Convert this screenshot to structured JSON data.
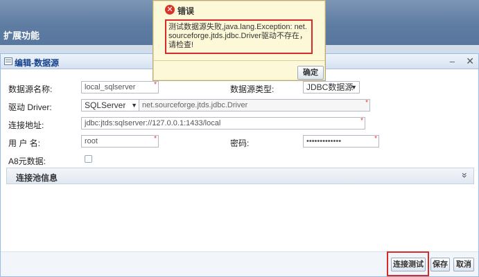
{
  "header": {
    "title": "扩展功能"
  },
  "window": {
    "title": "编辑-数据源",
    "minimize_glyph": "–",
    "close_glyph": "✕"
  },
  "form": {
    "ds_name_label": "数据源名称:",
    "ds_name_value": "local_sqlserver",
    "ds_type_label": "数据源类型:",
    "ds_type_value": "JDBC数据源",
    "driver_label": "驱动 Driver:",
    "driver_type_value": "SQLServer",
    "driver_class_value": "net.sourceforge.jtds.jdbc.Driver",
    "url_label": "连接地址:",
    "url_value": "jdbc:jtds:sqlserver://127.0.0.1:1433/local",
    "user_label": "用 户 名:",
    "user_value": "root",
    "password_label": "密码:",
    "password_value": "•••••••••••••",
    "a8_label": "A8元数据:",
    "required_mark": "*"
  },
  "pool_panel": {
    "title": "连接池信息",
    "expand_glyph": "»"
  },
  "footer": {
    "test_label": "连接测试",
    "save_label": "保存",
    "cancel_label": "取消"
  },
  "dialog": {
    "title": "错误",
    "icon_glyph": "✕",
    "message": "测试数据源失败,java.lang.Exception: net.sourceforge.jtds.jdbc.Driver驱动不存在，请检查!",
    "ok_label": "确定"
  },
  "colors": {
    "accent": "#15428b",
    "error": "#d92a2a",
    "dialog_bg": "#fdf8d8"
  }
}
